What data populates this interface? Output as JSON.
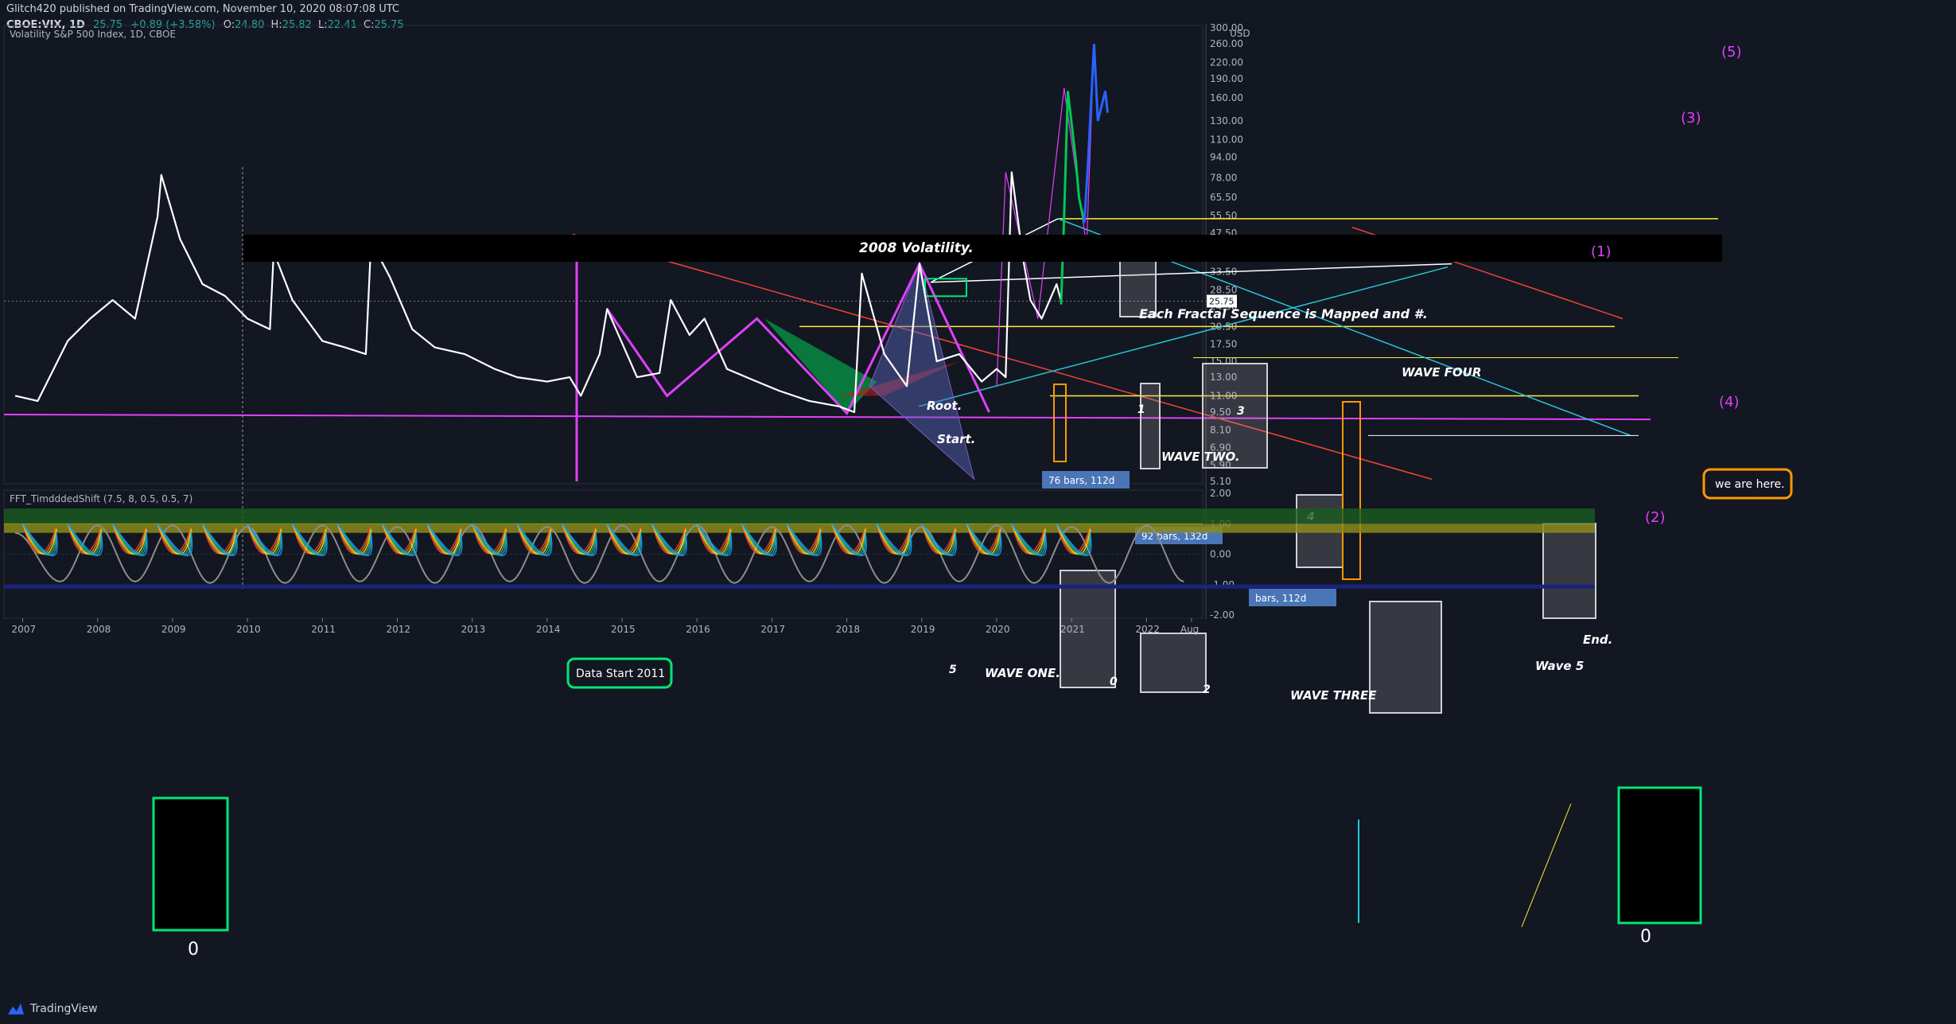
{
  "header": {
    "publisher_line": "Glitch420 published on TradingView.com, November 10, 2020 08:07:08 UTC",
    "symbol": "CBOE:VIX, 1D",
    "last": "25.75",
    "change": "+0.89 (+3.58%)",
    "ohlc_label_o": "O:",
    "ohlc_o": "24.80",
    "ohlc_label_h": "H:",
    "ohlc_h": "25.82",
    "ohlc_label_l": "L:",
    "ohlc_l": "22.41",
    "ohlc_label_c": "C:",
    "ohlc_c": "25.75"
  },
  "colors": {
    "background": "#131722",
    "price_line": "#ffffff",
    "magenta": "#e040fb",
    "yellow": "#ffeb3b",
    "cyan": "#26c6da",
    "red": "#f44336",
    "green": "#00e676",
    "orange": "#ff9800",
    "oscillator_green": "#1b5e20",
    "oscillator_olive": "#8a8a1a"
  },
  "footer": {
    "brand": "TradingView"
  },
  "chart_data": [
    {
      "type": "line",
      "title": "Volatility S&P 500 Index, 1D, CBOE",
      "y_scale": "log",
      "y_unit": "USD",
      "y_ticks": [
        "300.00",
        "260.00",
        "220.00",
        "190.00",
        "160.00",
        "130.00",
        "110.00",
        "94.00",
        "78.00",
        "65.50",
        "55.50",
        "47.50",
        "39.50",
        "33.50",
        "28.50",
        "24.50",
        "20.50",
        "17.50",
        "15.00",
        "13.00",
        "11.00",
        "9.50",
        "8.10",
        "6.90",
        "5.90",
        "5.10"
      ],
      "x_ticks": [
        "2007",
        "2008",
        "2009",
        "2010",
        "2011",
        "2012",
        "2013",
        "2014",
        "2015",
        "2016",
        "2017",
        "2018",
        "2019",
        "2020",
        "2021",
        "2022",
        "Aug"
      ],
      "last_price_label": "25.75",
      "x": [
        2006.9,
        2007.2,
        2007.6,
        2007.9,
        2008.2,
        2008.5,
        2008.8,
        2008.85,
        2009.1,
        2009.4,
        2009.7,
        2010.0,
        2010.3,
        2010.35,
        2010.6,
        2011.0,
        2011.3,
        2011.58,
        2011.65,
        2011.9,
        2012.2,
        2012.5,
        2012.9,
        2013.3,
        2013.6,
        2014.0,
        2014.3,
        2014.45,
        2014.7,
        2014.8,
        2015.2,
        2015.5,
        2015.65,
        2015.9,
        2016.1,
        2016.4,
        2016.8,
        2017.1,
        2017.5,
        2017.9,
        2018.1,
        2018.2,
        2018.5,
        2018.8,
        2018.97,
        2019.2,
        2019.5,
        2019.8,
        2020.0,
        2020.12,
        2020.2,
        2020.35,
        2020.45,
        2020.6,
        2020.8,
        2020.86
      ],
      "y": [
        11,
        10.5,
        18,
        22,
        26,
        22,
        55,
        80,
        45,
        30,
        27,
        22,
        20,
        40,
        26,
        18,
        17,
        16,
        44,
        32,
        20,
        17,
        16,
        14,
        13,
        12.5,
        13,
        11,
        16,
        24,
        13,
        13.5,
        26,
        19,
        22,
        14,
        12.5,
        11.5,
        10.5,
        10,
        9.5,
        33,
        16,
        12,
        36,
        15,
        16,
        12.5,
        14,
        13,
        82,
        38,
        26,
        22,
        30,
        25.75
      ],
      "ilabel_text": "Each Fractal Sequence is Mapped and #.",
      "annotations": {
        "volatility_2008": "2008 Volatility.",
        "fractal_note": "Each Fractal Sequence is Mapped and #.",
        "data_start": "Data Start 2011",
        "we_are_here": "we are here.",
        "root": "Root.",
        "start": "Start.",
        "end": "End.",
        "wave_one": "WAVE ONE.",
        "wave_two": "WAVE TWO.",
        "wave_three": "WAVE THREE",
        "wave_four": "WAVE FOUR",
        "wave_five": "Wave 5",
        "num_1": "1",
        "num_2": "2",
        "num_3": "3",
        "num_4": "4",
        "num_5": "5",
        "num_0": "0",
        "bars_1": "76 bars, 112d",
        "bars_2": "92 bars, 132d",
        "bars_3": "bars, 112d",
        "p1": "(1)",
        "p2": "(2)",
        "p3": "(3)",
        "p4": "(4)",
        "p5": "(5)"
      }
    },
    {
      "type": "line",
      "title": "FFT_TimdddedShift (7.5, 8, 0.5, 0.5, 7)",
      "y_ticks": [
        "2.00",
        "1.00",
        "0.00",
        "-1.00",
        "-2.00"
      ],
      "series": [
        {
          "x": [
            2006.9,
            2007.5,
            2008.0,
            2008.5,
            2009.0,
            2009.5,
            2010.0,
            2010.5,
            2011.0,
            2011.5,
            2012.0,
            2012.5,
            2013.0,
            2013.5,
            2014.0,
            2014.5,
            2015.0,
            2015.5,
            2016.0,
            2016.5,
            2017.0,
            2017.5,
            2018.0,
            2018.5,
            2019.0,
            2019.5,
            2020.0,
            2020.5,
            2021.0,
            2021.5,
            2022.0,
            2022.5
          ],
          "values": [
            0.7,
            -0.9,
            0.95,
            -0.9,
            0.95,
            -0.95,
            0.9,
            -0.95,
            0.95,
            -0.9,
            0.9,
            -0.95,
            0.95,
            -0.9,
            0.9,
            -0.95,
            0.95,
            -0.9,
            0.95,
            -0.95,
            0.9,
            -0.9,
            0.95,
            -0.95,
            0.9,
            -0.9,
            0.95,
            -0.95,
            0.9,
            -0.95,
            0.95,
            -0.9
          ]
        }
      ],
      "labels": {
        "zero_left": "0",
        "zero_right": "0"
      }
    }
  ]
}
